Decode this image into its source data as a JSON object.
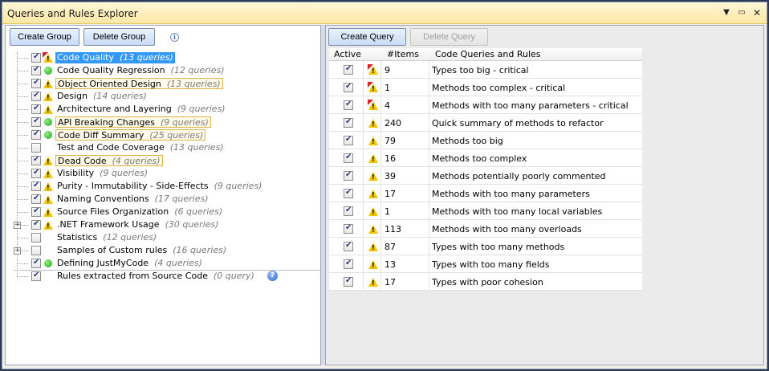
{
  "window": {
    "title": "Queries and Rules Explorer",
    "pin_glyph": "▼",
    "max_glyph": "▭",
    "close_glyph": "✕"
  },
  "left_toolbar": {
    "create_group": "Create Group",
    "delete_group": "Delete Group",
    "info_glyph": "i"
  },
  "right_toolbar": {
    "create_query": "Create Query",
    "delete_query": "Delete Query"
  },
  "tree": [
    {
      "label": "Code Quality",
      "count": "(13 queries)",
      "checked": true,
      "status": "warn-critical",
      "style": "selected",
      "expander": ""
    },
    {
      "label": "Code Quality Regression",
      "count": "(12 queries)",
      "checked": true,
      "status": "ok",
      "style": "",
      "expander": ""
    },
    {
      "label": "Object Oriented Design",
      "count": "(13 queries)",
      "checked": true,
      "status": "warn",
      "style": "outlined",
      "expander": ""
    },
    {
      "label": "Design",
      "count": "(14 queries)",
      "checked": true,
      "status": "warn",
      "style": "",
      "expander": ""
    },
    {
      "label": "Architecture and Layering",
      "count": "(9 queries)",
      "checked": true,
      "status": "warn",
      "style": "",
      "expander": ""
    },
    {
      "label": "API Breaking Changes",
      "count": "(9 queries)",
      "checked": true,
      "status": "ok",
      "style": "outlined",
      "expander": ""
    },
    {
      "label": "Code Diff Summary",
      "count": "(25 queries)",
      "checked": true,
      "status": "ok",
      "style": "outlined",
      "expander": ""
    },
    {
      "label": "Test and Code Coverage",
      "count": "(13 queries)",
      "checked": false,
      "status": "",
      "style": "",
      "expander": ""
    },
    {
      "label": "Dead Code",
      "count": "(4 queries)",
      "checked": true,
      "status": "warn",
      "style": "outlined",
      "expander": ""
    },
    {
      "label": "Visibility",
      "count": "(9 queries)",
      "checked": true,
      "status": "warn",
      "style": "",
      "expander": ""
    },
    {
      "label": "Purity - Immutability - Side-Effects",
      "count": "(9 queries)",
      "checked": true,
      "status": "warn",
      "style": "",
      "expander": ""
    },
    {
      "label": "Naming Conventions",
      "count": "(17 queries)",
      "checked": true,
      "status": "warn",
      "style": "",
      "expander": ""
    },
    {
      "label": "Source Files Organization",
      "count": "(6 queries)",
      "checked": true,
      "status": "warn",
      "style": "",
      "expander": ""
    },
    {
      "label": ".NET Framework Usage",
      "count": "(30 queries)",
      "checked": true,
      "status": "warn",
      "style": "",
      "expander": "+"
    },
    {
      "label": "Statistics",
      "count": "(12 queries)",
      "checked": false,
      "status": "",
      "style": "",
      "expander": ""
    },
    {
      "label": "Samples of Custom rules",
      "count": "(16 queries)",
      "checked": false,
      "status": "",
      "style": "",
      "expander": "+"
    },
    {
      "label": "Defining JustMyCode",
      "count": "(4 queries)",
      "checked": true,
      "status": "ok",
      "style": "",
      "expander": ""
    },
    {
      "label": "Rules extracted from Source Code",
      "count": "(0 query)",
      "checked": true,
      "status": "",
      "style": "",
      "expander": "",
      "help": "?"
    }
  ],
  "grid": {
    "headers": {
      "active": "Active",
      "items": "#Items",
      "name": "Code Queries and Rules"
    },
    "rows": [
      {
        "active": true,
        "critical": true,
        "items": "9",
        "name": "Types too big - critical"
      },
      {
        "active": true,
        "critical": true,
        "items": "1",
        "name": "Methods too complex - critical"
      },
      {
        "active": true,
        "critical": true,
        "items": "4",
        "name": "Methods with too many parameters - critical"
      },
      {
        "active": true,
        "critical": false,
        "items": "240",
        "name": "Quick summary of methods to refactor"
      },
      {
        "active": true,
        "critical": false,
        "items": "79",
        "name": "Methods too big"
      },
      {
        "active": true,
        "critical": false,
        "items": "16",
        "name": "Methods too complex"
      },
      {
        "active": true,
        "critical": false,
        "items": "39",
        "name": "Methods potentially poorly commented"
      },
      {
        "active": true,
        "critical": false,
        "items": "17",
        "name": "Methods with too many parameters"
      },
      {
        "active": true,
        "critical": false,
        "items": "1",
        "name": "Methods with too many local variables"
      },
      {
        "active": true,
        "critical": false,
        "items": "113",
        "name": "Methods with too many overloads"
      },
      {
        "active": true,
        "critical": false,
        "items": "87",
        "name": "Types with too many methods"
      },
      {
        "active": true,
        "critical": false,
        "items": "13",
        "name": "Types with too many fields"
      },
      {
        "active": true,
        "critical": false,
        "items": "17",
        "name": "Types with poor cohesion"
      }
    ]
  }
}
